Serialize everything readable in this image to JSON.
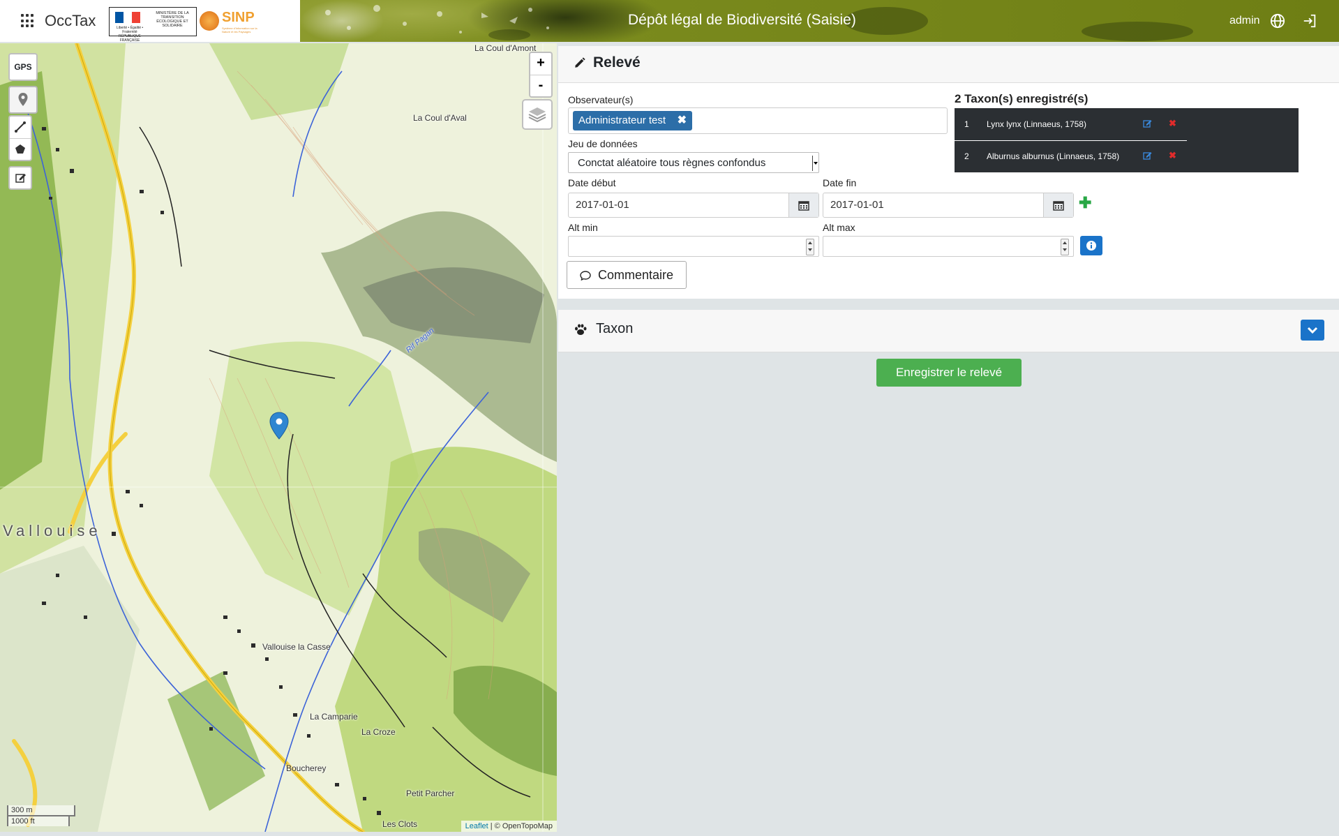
{
  "header": {
    "app_name": "OccTax",
    "title": "Dépôt légal de Biodiversité (Saisie)",
    "user": "admin",
    "logo_ministry_text": "MINISTÈRE DE LA TRANSITION ÉCOLOGIQUE ET SOLIDAIRE",
    "logo_republic_text": "Liberté • Égalité • Fraternité RÉPUBLIQUE FRANÇAISE",
    "logo_sinp": "SINP",
    "logo_sinp_sub": "Système d'Information sur la Nature et les Paysages",
    "icons": [
      "apps-grid-icon",
      "globe-icon",
      "logout-icon"
    ]
  },
  "map": {
    "gps_label": "GPS",
    "zoom_in": "+",
    "zoom_out": "-",
    "scale_metric": "300 m",
    "scale_imperial": "1000 ft",
    "attribution_link": "Leaflet",
    "attribution_text": "| © OpenTopoMap",
    "labels": {
      "la_coul_amont": "La Coul d'Amont",
      "la_coul_aval": "La Coul d'Aval",
      "vallouise": "Vallouise",
      "vallouise_casse": "Vallouise la Casse",
      "la_camparie": "La Camparie",
      "la_croze": "La Croze",
      "boucherey": "Boucherey",
      "petit_parcher": "Petit Parcher",
      "les_clots": "Les Clots",
      "rif_pagan": "Rif Pagan"
    }
  },
  "releve": {
    "title": "Relevé",
    "observers_label": "Observateur(s)",
    "observer_tag": "Administrateur test",
    "dataset_label": "Jeu de données",
    "dataset_value": "Conctat aléatoire tous règnes confondus",
    "date_start_label": "Date début",
    "date_start_value": "2017-01-01",
    "date_end_label": "Date fin",
    "date_end_value": "2017-01-01",
    "alt_min_label": "Alt min",
    "alt_max_label": "Alt max",
    "comment_button": "Commentaire",
    "taxa_title": "2 Taxon(s) enregistré(s)",
    "taxa": [
      {
        "num": "1",
        "name": "Lynx lynx (Linnaeus, 1758)"
      },
      {
        "num": "2",
        "name": "Alburnus alburnus (Linnaeus, 1758)"
      }
    ],
    "delete_symbol": "✖"
  },
  "taxon": {
    "title": "Taxon"
  },
  "save_button": "Enregistrer le relevé",
  "colors": {
    "header_green": "#7b8a1c",
    "tag_blue": "#2c6ea8",
    "primary_blue": "#1a73c9",
    "success_green": "#4caf50",
    "danger_red": "#e02b2b"
  }
}
